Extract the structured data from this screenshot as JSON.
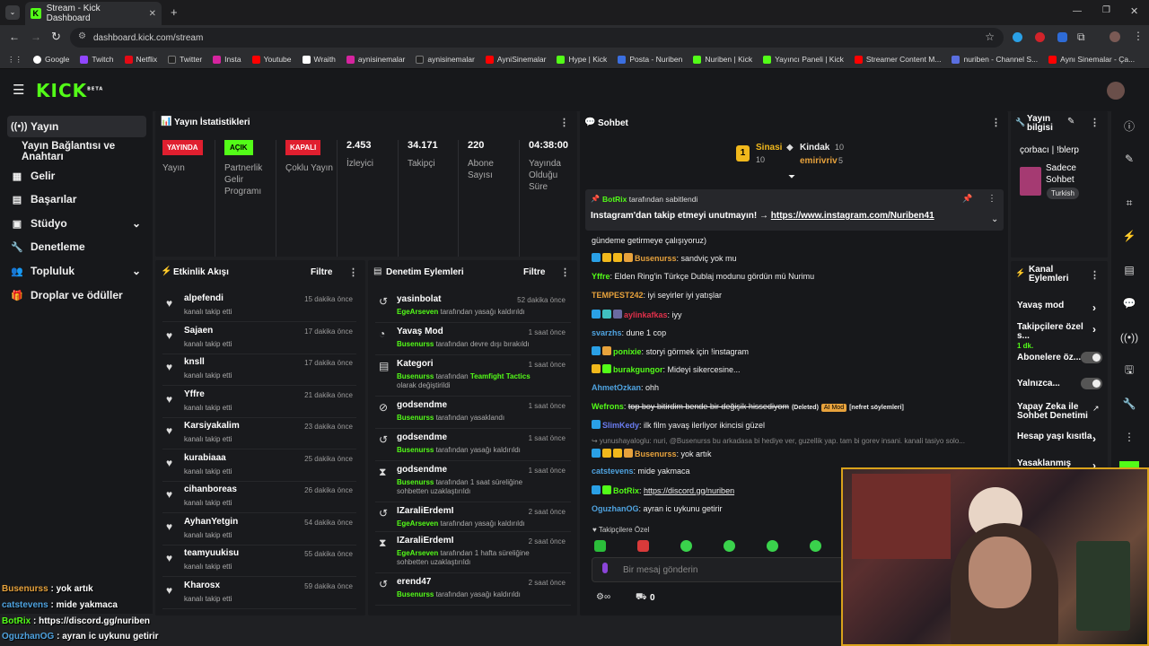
{
  "browser": {
    "tab_title": "Stream - Kick Dashboard",
    "url": "dashboard.kick.com/stream",
    "bookmarks": [
      "Google",
      "Twitch",
      "Netflix",
      "Twitter",
      "Insta",
      "Youtube",
      "Wraith",
      "aynisinemalar",
      "aynisinemalar",
      "AyniSinemalar",
      "Hype | Kick",
      "Posta - Nuriben",
      "Nuriben | Kick",
      "Yayıncı Paneli | Kick",
      "Streamer Content M...",
      "nuriben - Channel S...",
      "Aynı Sinemalar - Ça..."
    ]
  },
  "header": {
    "logo": "KICK",
    "logo_sup": "BETA"
  },
  "sidebar": {
    "items": [
      {
        "label": "Yayın",
        "icon": "broadcast-icon"
      },
      {
        "label": "Yayın Bağlantısı ve Anahtarı"
      },
      {
        "label": "Gelir",
        "icon": "revenue-icon"
      },
      {
        "label": "Başarılar",
        "icon": "achievements-icon"
      },
      {
        "label": "Stüdyo",
        "icon": "studio-icon"
      },
      {
        "label": "Denetleme",
        "icon": "moderation-icon"
      },
      {
        "label": "Topluluk",
        "icon": "community-icon"
      },
      {
        "label": "Droplar ve ödüller",
        "icon": "drops-icon"
      }
    ]
  },
  "stats": {
    "title": "Yayın İstatistikleri",
    "cols": [
      {
        "badge": "YAYINDA",
        "label": "Yayın"
      },
      {
        "badge": "AÇIK",
        "label": "Partnerlik Gelir Programı"
      },
      {
        "badge": "KAPALI",
        "label": "Çoklu Yayın"
      },
      {
        "value": "2.453",
        "label": "İzleyici"
      },
      {
        "value": "34.171",
        "label": "Takipçi"
      },
      {
        "value": "220",
        "label": "Abone Sayısı"
      },
      {
        "value": "04:38:00",
        "label": "Yayında Olduğu Süre"
      }
    ]
  },
  "activity": {
    "title": "Etkinlik Akışı",
    "filter": "Filtre",
    "items": [
      {
        "name": "alpefendi",
        "sub": "kanalı takip etti",
        "time": "15 dakika önce"
      },
      {
        "name": "Sajaen",
        "sub": "kanalı takip etti",
        "time": "17 dakika önce"
      },
      {
        "name": "knsll",
        "sub": "kanalı takip etti",
        "time": "17 dakika önce"
      },
      {
        "name": "Yffre",
        "sub": "kanalı takip etti",
        "time": "21 dakika önce"
      },
      {
        "name": "Karsiyakalim",
        "sub": "kanalı takip etti",
        "time": "23 dakika önce"
      },
      {
        "name": "kurabiaaa",
        "sub": "kanalı takip etti",
        "time": "25 dakika önce"
      },
      {
        "name": "cihanboreas",
        "sub": "kanalı takip etti",
        "time": "26 dakika önce"
      },
      {
        "name": "AyhanYetgin",
        "sub": "kanalı takip etti",
        "time": "54 dakika önce"
      },
      {
        "name": "teamyuukisu",
        "sub": "kanalı takip etti",
        "time": "55 dakika önce"
      },
      {
        "name": "Kharosx",
        "sub": "kanalı takip etti",
        "time": "59 dakika önce"
      }
    ]
  },
  "moderation": {
    "title": "Denetim Eylemleri",
    "filter": "Filtre",
    "items": [
      {
        "name": "yasinbolat",
        "mod": "EgeArseven",
        "text": " tarafından yasağı kaldırıldı",
        "time": "52 dakika önce",
        "icon": "↺"
      },
      {
        "name": "Yavaş Mod",
        "mod": "Busenurss",
        "text": " tarafından devre dışı bırakıldı",
        "time": "1 saat önce",
        "icon": "◔"
      },
      {
        "name": "Kategori",
        "mod": "Busenurss",
        "text": " tarafından ",
        "extra": "Teamfight Tactics",
        "extra2": " olarak değiştirildi",
        "time": "1 saat önce",
        "icon": "▤"
      },
      {
        "name": "godsendme",
        "mod": "Busenurss",
        "text": " tarafından yasaklandı",
        "time": "1 saat önce",
        "icon": "⊘"
      },
      {
        "name": "godsendme",
        "mod": "Busenurss",
        "text": " tarafından yasağı kaldırıldı",
        "time": "1 saat önce",
        "icon": "↺"
      },
      {
        "name": "godsendme",
        "mod": "Busenurss",
        "text": " tarafından 1 saat süreliğine sohbetten uzaklaştırıldı",
        "time": "1 saat önce",
        "icon": "⧗"
      },
      {
        "name": "IZaraliErdemI",
        "mod": "EgeArseven",
        "text": " tarafından yasağı kaldırıldı",
        "time": "2 saat önce",
        "icon": "↺"
      },
      {
        "name": "IZaraliErdemI",
        "mod": "EgeArseven",
        "text": " tarafından 1 hafta süreliğine sohbetten uzaklaştırıldı",
        "time": "2 saat önce",
        "icon": "⧗"
      },
      {
        "name": "erend47",
        "mod": "Busenurss",
        "text": " tarafından yasağı kaldırıldı",
        "time": "2 saat önce",
        "icon": "↺"
      }
    ]
  },
  "chat": {
    "title": "Sohbet",
    "leader1": {
      "name": "Sinasi",
      "count": "10",
      "rank": "1"
    },
    "leader2": {
      "name": "Kindak",
      "count": "10"
    },
    "leader3": {
      "name": "emirivriv",
      "count": "5"
    },
    "pinned_by": "BotRix",
    "pinned_suffix": " tarafından sabitlendi",
    "pinned_text": "Instagram'dan takip etmeyi unutmayın! → ",
    "pinned_link": "https://www.instagram.com/Nuriben41",
    "messages": [
      {
        "user": "",
        "text": "gündeme getirmeye çalışıyoruz)"
      },
      {
        "user": "Busenurss",
        "text": ": sandviç yok mu"
      },
      {
        "user": "Yffre",
        "text": ": Elden Ring'in Türkçe Dublaj modunu gördün mü Nurimu"
      },
      {
        "user": "TEMPEST242",
        "text": ": iyi seyirler iyi yatışlar"
      },
      {
        "user": "aylinkafkas",
        "text": ": iyy"
      },
      {
        "user": "svarzhs",
        "text": ": dune 1 cop"
      },
      {
        "user": "ponixie",
        "text": ": storyi görmek için !instagram"
      },
      {
        "user": "burakgungor",
        "text": ": Mideyi sikercesine..."
      },
      {
        "user": "AhmetOzkan",
        "text": ": ohh"
      },
      {
        "user": "Wefrons",
        "text": ": ",
        "deleted": "top boy bitirdim bende bir değişik hissediyom",
        "del_tag": "(Deleted)",
        "ai": "AI Mod",
        "reason": "[nefret söylemleri]"
      },
      {
        "user": "SlimKedy",
        "text": ": ilk film yavaş ilerliyor ikincisi güzel"
      },
      {
        "user": "",
        "text": "↪ yunushayaloglu: nuri, @Busenurss bu arkadasa bi hediye ver, guzellik yap. tam bi gorev insani. kanali tasiyo solo..."
      },
      {
        "user": "Busenurss",
        "text": ": yok artık"
      },
      {
        "user": "catstevens",
        "text": ": mide yakmaca"
      },
      {
        "user": "BotRix",
        "text": ": ",
        "link": "https://discord.gg/nuriben"
      },
      {
        "user": "OguzhanOG",
        "text": ": ayran ic uykunu getirir"
      }
    ],
    "followers_only": "Takipçilere Özel",
    "input_placeholder": "Bir mesaj gönderin",
    "footer_count": "0"
  },
  "info": {
    "title": "Yayın bilgisi",
    "stream_title": "çorbacı | !blerp",
    "category": "Sadece Sohbet",
    "tag": "Turkish"
  },
  "channel_actions": {
    "title": "Kanal Eylemleri",
    "items": [
      {
        "label": "Yavaş mod",
        "type": "arrow"
      },
      {
        "label": "Takipçilere özel s...",
        "sub": "1 dk.",
        "type": "arrow"
      },
      {
        "label": "Abonelere öz...",
        "type": "toggle"
      },
      {
        "label": "Yalnızca...",
        "type": "toggle"
      },
      {
        "label": "Yapay Zeka ile Sohbet Denetimi",
        "type": "link"
      },
      {
        "label": "Hesap yaşı kısıtla",
        "type": "arrow"
      },
      {
        "label": "Yasaklanmış kelin...",
        "type": "arrow"
      }
    ]
  },
  "overlay": {
    "lines": [
      {
        "user": "Busenurss",
        "text": " : yok artık"
      },
      {
        "user": "catstevens",
        "text": " : mide yakmaca"
      },
      {
        "user": "BotRix",
        "text": " : https://discord.gg/nuriben"
      },
      {
        "user": "OguzhanOG",
        "text": " : ayran ic uykunu getirir"
      }
    ]
  },
  "colors": {
    "accent": "#53fc18",
    "live": "#e01f2f",
    "gold": "#d9a21b"
  }
}
